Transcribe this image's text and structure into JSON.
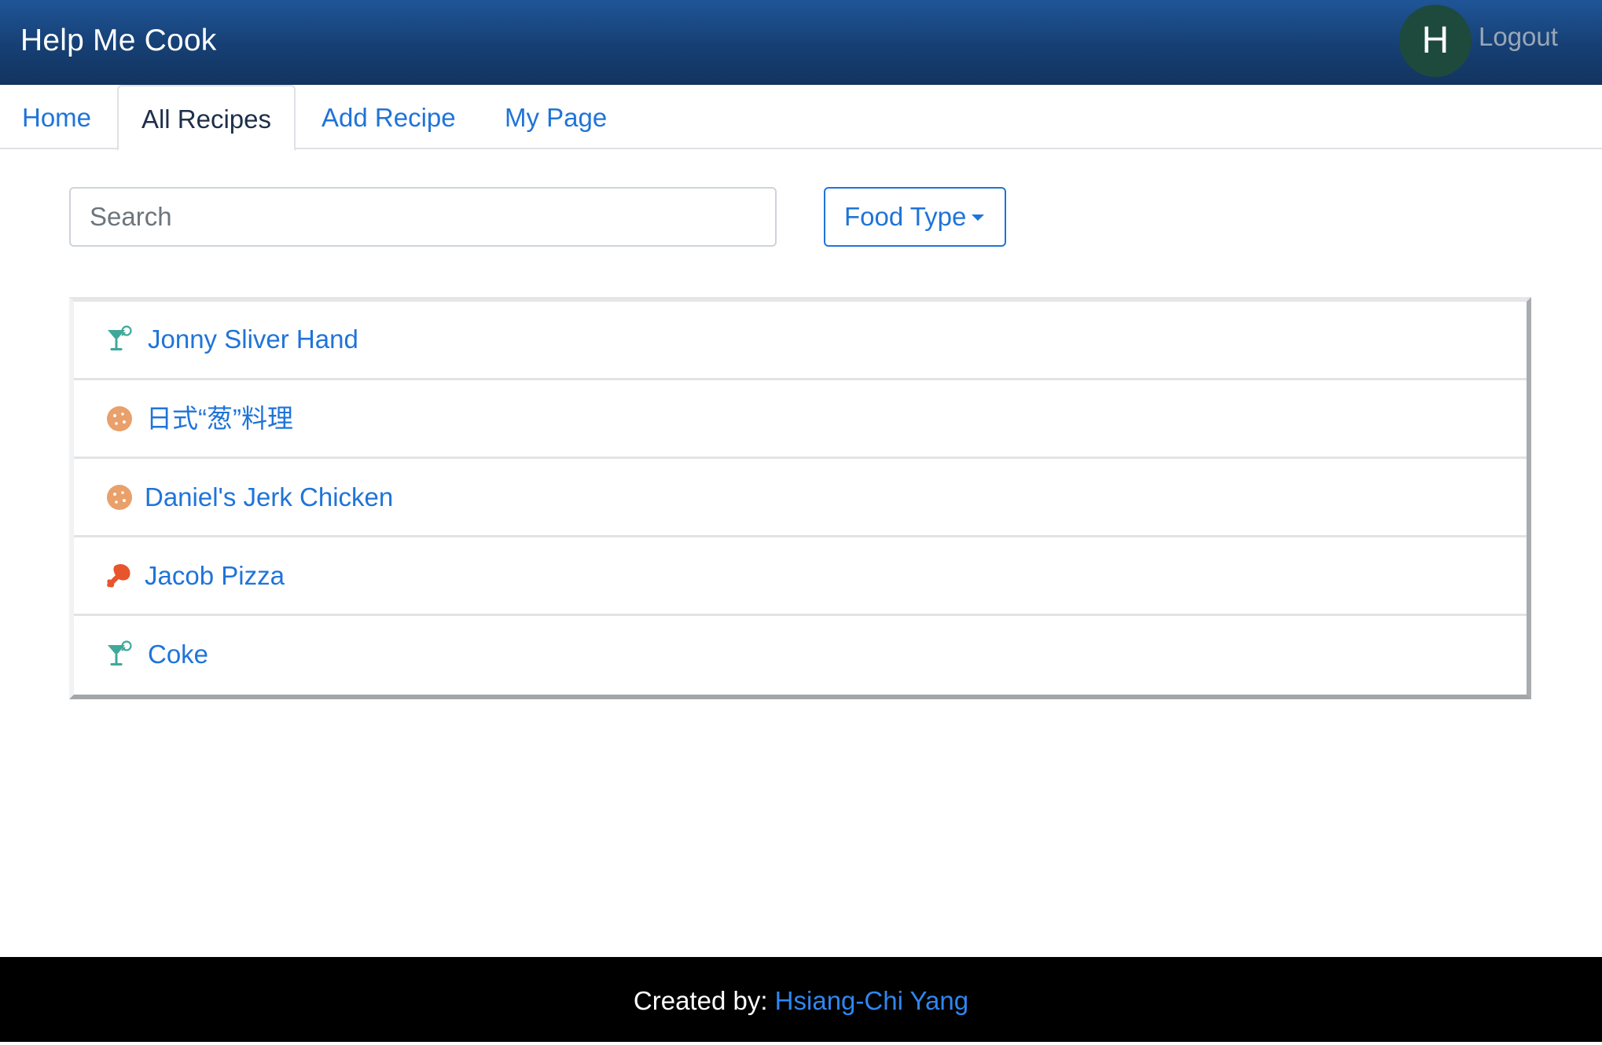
{
  "header": {
    "brand": "Help Me Cook",
    "avatar_initial": "H",
    "logout_label": "Logout",
    "colors": {
      "bar": "#1a4a86",
      "avatar": "#1d4a3d"
    }
  },
  "tabs": [
    {
      "label": "Home",
      "active": false
    },
    {
      "label": "All Recipes",
      "active": true
    },
    {
      "label": "Add Recipe",
      "active": false
    },
    {
      "label": "My Page",
      "active": false
    }
  ],
  "search": {
    "placeholder": "Search",
    "value": ""
  },
  "filter": {
    "label": "Food Type"
  },
  "recipes": [
    {
      "name": "Jonny Sliver Hand",
      "icon": "cocktail-icon",
      "icon_color": "#3fa89a"
    },
    {
      "name": "日式“葱”料理",
      "icon": "cookie-icon",
      "icon_color": "#e9a06a"
    },
    {
      "name": "Daniel's Jerk Chicken",
      "icon": "cookie-icon",
      "icon_color": "#e9a06a"
    },
    {
      "name": "Jacob Pizza",
      "icon": "drumstick-icon",
      "icon_color": "#e8542c"
    },
    {
      "name": "Coke",
      "icon": "cocktail-icon",
      "icon_color": "#3fa89a"
    }
  ],
  "footer": {
    "prefix": "Created by: ",
    "author": "Hsiang-Chi Yang",
    "author_color": "#2f86f0"
  }
}
